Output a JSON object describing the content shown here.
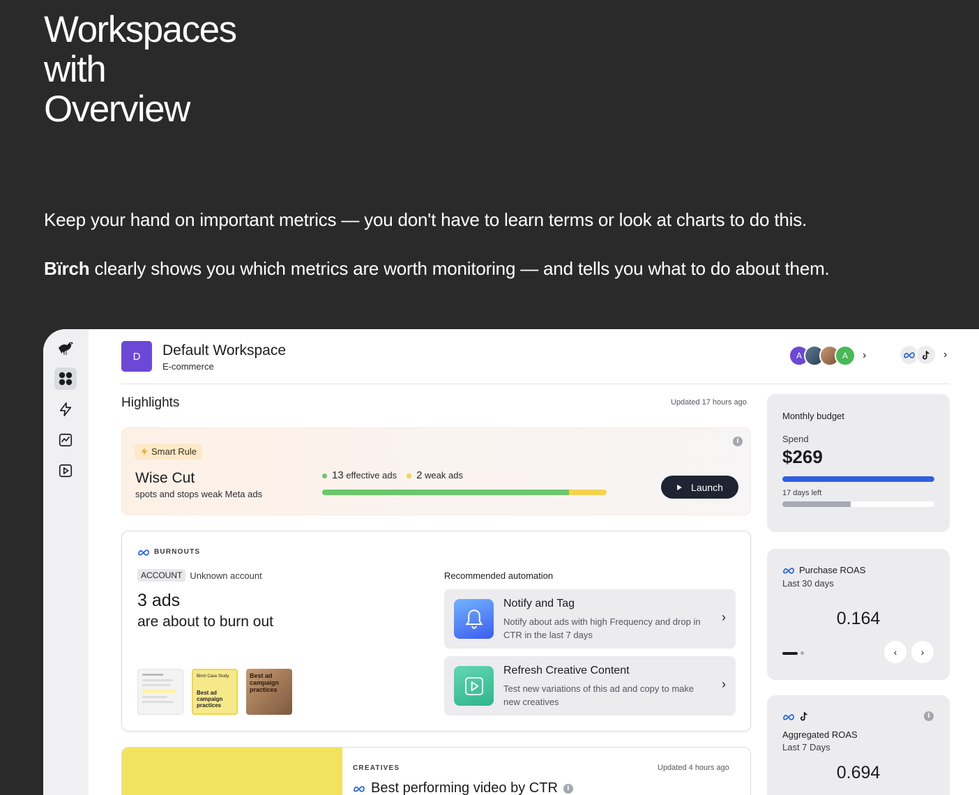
{
  "hero": {
    "title_lines": [
      "Workspaces",
      "with",
      "Overview"
    ],
    "tagline1": "Keep your hand on important metrics — you don't have to learn terms or look at charts to do this.",
    "tagline2_brand": "Bïrch",
    "tagline2_rest": " clearly shows you which metrics are worth monitoring — and tells you what to do about them."
  },
  "rail": {
    "items": [
      {
        "icon": "bird-logo-icon"
      },
      {
        "icon": "dashboard-grid-icon",
        "active": true
      },
      {
        "icon": "lightning-icon"
      },
      {
        "icon": "chart-icon"
      },
      {
        "icon": "play-icon"
      }
    ]
  },
  "workspace": {
    "badge": "D",
    "name": "Default Workspace",
    "type": "E-commerce",
    "avatars": [
      "A",
      "",
      "",
      "A"
    ]
  },
  "highlights": {
    "title": "Highlights",
    "updated": "Updated 17 hours ago"
  },
  "smart_rule": {
    "tag": "Smart Rule",
    "name": "Wise Cut",
    "description": "spots and stops weak Meta ads",
    "effective_count": "13",
    "effective_label": "effective ads",
    "weak_count": "2",
    "weak_label": "weak ads",
    "effective_fraction": 0.867,
    "launch_label": "Launch",
    "colors": {
      "effective": "#6cc76a",
      "weak": "#f6d24f"
    }
  },
  "burnouts": {
    "kicker": "BURNOUTS",
    "account_pill": "ACCOUNT",
    "account_name": "Unknown account",
    "count": "3 ads",
    "subtitle": "are about to burn out",
    "recommended_title": "Recommended automation",
    "automations": [
      {
        "title": "Notify and Tag",
        "desc": "Notify about ads with high Frequency and drop in CTR in the last 7 days",
        "icon": "bell-icon"
      },
      {
        "title": "Refresh Creative Content",
        "desc": "Test new variations of this ad and copy to make new creatives",
        "icon": "play-box-icon"
      }
    ],
    "thumbs": [
      {
        "text": ""
      },
      {
        "text_top": "Birch Case Study",
        "text_main": "Best ad campaign practices"
      },
      {
        "text_main": "Best ad campaign practices"
      }
    ]
  },
  "creatives": {
    "kicker": "CREATIVES",
    "updated": "Updated 4 hours ago",
    "title": "Best performing video by CTR"
  },
  "budget": {
    "title": "Monthly budget",
    "spend_label": "Spend",
    "spend_value": "$269",
    "spend_fraction": 1.0,
    "days_left": "17 days left",
    "days_fraction": 0.45,
    "colors": {
      "spend": "#2f5fe0",
      "days": "#a9a9b3"
    }
  },
  "roas": {
    "title": "Purchase ROAS",
    "period": "Last 30 days",
    "value": "0.164",
    "prev": "‹",
    "next": "›"
  },
  "agg": {
    "title": "Aggregated ROAS",
    "period": "Last 7 Days",
    "value": "0.694"
  }
}
